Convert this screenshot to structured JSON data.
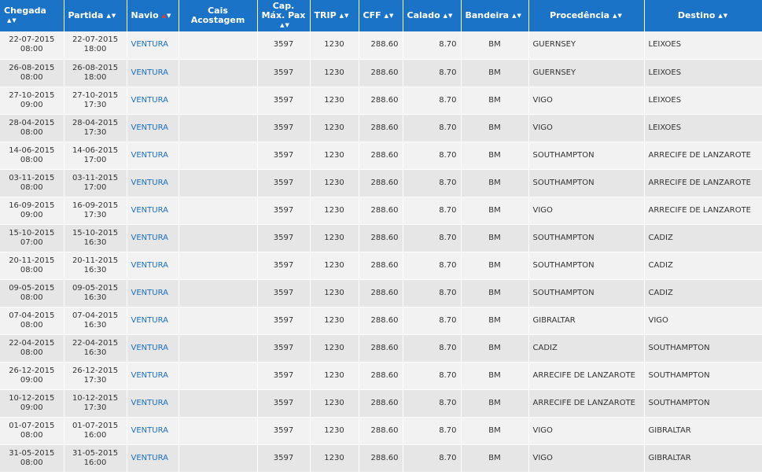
{
  "headers": [
    {
      "label": "Chegada",
      "sort": "both"
    },
    {
      "label": "Partida",
      "sort": "both"
    },
    {
      "label": "Navio",
      "sort": "up-active"
    },
    {
      "label": "Cais Acostagem",
      "sort": "none"
    },
    {
      "label": "Cap. Máx. Pax",
      "sort": "both"
    },
    {
      "label": "TRIP",
      "sort": "both"
    },
    {
      "label": "CFF",
      "sort": "both"
    },
    {
      "label": "Calado",
      "sort": "both"
    },
    {
      "label": "Bandeira",
      "sort": "both"
    },
    {
      "label": "Procedência",
      "sort": "both"
    },
    {
      "label": "Destino",
      "sort": "both"
    }
  ],
  "rows": [
    {
      "arr_date": "22-07-2015",
      "arr_time": "08:00",
      "dep_date": "22-07-2015",
      "dep_time": "18:00",
      "ship": "VENTURA",
      "berth": "",
      "pax": "3597",
      "trip": "1230",
      "cff": "288.60",
      "draft": "8.70",
      "flag": "BM",
      "from": "GUERNSEY",
      "to": "LEIXOES"
    },
    {
      "arr_date": "26-08-2015",
      "arr_time": "08:00",
      "dep_date": "26-08-2015",
      "dep_time": "18:00",
      "ship": "VENTURA",
      "berth": "",
      "pax": "3597",
      "trip": "1230",
      "cff": "288.60",
      "draft": "8.70",
      "flag": "BM",
      "from": "GUERNSEY",
      "to": "LEIXOES"
    },
    {
      "arr_date": "27-10-2015",
      "arr_time": "09:00",
      "dep_date": "27-10-2015",
      "dep_time": "17:30",
      "ship": "VENTURA",
      "berth": "",
      "pax": "3597",
      "trip": "1230",
      "cff": "288.60",
      "draft": "8.70",
      "flag": "BM",
      "from": "VIGO",
      "to": "LEIXOES"
    },
    {
      "arr_date": "28-04-2015",
      "arr_time": "08:00",
      "dep_date": "28-04-2015",
      "dep_time": "17:30",
      "ship": "VENTURA",
      "berth": "",
      "pax": "3597",
      "trip": "1230",
      "cff": "288.60",
      "draft": "8.70",
      "flag": "BM",
      "from": "VIGO",
      "to": "LEIXOES"
    },
    {
      "arr_date": "14-06-2015",
      "arr_time": "08:00",
      "dep_date": "14-06-2015",
      "dep_time": "17:00",
      "ship": "VENTURA",
      "berth": "",
      "pax": "3597",
      "trip": "1230",
      "cff": "288.60",
      "draft": "8.70",
      "flag": "BM",
      "from": "SOUTHAMPTON",
      "to": "ARRECIFE DE LANZAROTE"
    },
    {
      "arr_date": "03-11-2015",
      "arr_time": "08:00",
      "dep_date": "03-11-2015",
      "dep_time": "17:00",
      "ship": "VENTURA",
      "berth": "",
      "pax": "3597",
      "trip": "1230",
      "cff": "288.60",
      "draft": "8.70",
      "flag": "BM",
      "from": "SOUTHAMPTON",
      "to": "ARRECIFE DE LANZAROTE"
    },
    {
      "arr_date": "16-09-2015",
      "arr_time": "09:00",
      "dep_date": "16-09-2015",
      "dep_time": "17:30",
      "ship": "VENTURA",
      "berth": "",
      "pax": "3597",
      "trip": "1230",
      "cff": "288.60",
      "draft": "8.70",
      "flag": "BM",
      "from": "VIGO",
      "to": "ARRECIFE DE LANZAROTE"
    },
    {
      "arr_date": "15-10-2015",
      "arr_time": "07:00",
      "dep_date": "15-10-2015",
      "dep_time": "16:30",
      "ship": "VENTURA",
      "berth": "",
      "pax": "3597",
      "trip": "1230",
      "cff": "288.60",
      "draft": "8.70",
      "flag": "BM",
      "from": "SOUTHAMPTON",
      "to": "CADIZ"
    },
    {
      "arr_date": "20-11-2015",
      "arr_time": "08:00",
      "dep_date": "20-11-2015",
      "dep_time": "16:30",
      "ship": "VENTURA",
      "berth": "",
      "pax": "3597",
      "trip": "1230",
      "cff": "288.60",
      "draft": "8.70",
      "flag": "BM",
      "from": "SOUTHAMPTON",
      "to": "CADIZ"
    },
    {
      "arr_date": "09-05-2015",
      "arr_time": "08:00",
      "dep_date": "09-05-2015",
      "dep_time": "16:30",
      "ship": "VENTURA",
      "berth": "",
      "pax": "3597",
      "trip": "1230",
      "cff": "288.60",
      "draft": "8.70",
      "flag": "BM",
      "from": "SOUTHAMPTON",
      "to": "CADIZ"
    },
    {
      "arr_date": "07-04-2015",
      "arr_time": "08:00",
      "dep_date": "07-04-2015",
      "dep_time": "16:30",
      "ship": "VENTURA",
      "berth": "",
      "pax": "3597",
      "trip": "1230",
      "cff": "288.60",
      "draft": "8.70",
      "flag": "BM",
      "from": "GIBRALTAR",
      "to": "VIGO"
    },
    {
      "arr_date": "22-04-2015",
      "arr_time": "08:00",
      "dep_date": "22-04-2015",
      "dep_time": "16:30",
      "ship": "VENTURA",
      "berth": "",
      "pax": "3597",
      "trip": "1230",
      "cff": "288.60",
      "draft": "8.70",
      "flag": "BM",
      "from": "CADIZ",
      "to": "SOUTHAMPTON"
    },
    {
      "arr_date": "26-12-2015",
      "arr_time": "09:00",
      "dep_date": "26-12-2015",
      "dep_time": "17:30",
      "ship": "VENTURA",
      "berth": "",
      "pax": "3597",
      "trip": "1230",
      "cff": "288.60",
      "draft": "8.70",
      "flag": "BM",
      "from": "ARRECIFE DE LANZAROTE",
      "to": "SOUTHAMPTON"
    },
    {
      "arr_date": "10-12-2015",
      "arr_time": "09:00",
      "dep_date": "10-12-2015",
      "dep_time": "17:30",
      "ship": "VENTURA",
      "berth": "",
      "pax": "3597",
      "trip": "1230",
      "cff": "288.60",
      "draft": "8.70",
      "flag": "BM",
      "from": "ARRECIFE DE LANZAROTE",
      "to": "SOUTHAMPTON"
    },
    {
      "arr_date": "01-07-2015",
      "arr_time": "08:00",
      "dep_date": "01-07-2015",
      "dep_time": "16:00",
      "ship": "VENTURA",
      "berth": "",
      "pax": "3597",
      "trip": "1230",
      "cff": "288.60",
      "draft": "8.70",
      "flag": "BM",
      "from": "VIGO",
      "to": "GIBRALTAR"
    },
    {
      "arr_date": "31-05-2015",
      "arr_time": "08:00",
      "dep_date": "31-05-2015",
      "dep_time": "16:00",
      "ship": "VENTURA",
      "berth": "",
      "pax": "3597",
      "trip": "1230",
      "cff": "288.60",
      "draft": "8.70",
      "flag": "BM",
      "from": "VIGO",
      "to": "GIBRALTAR"
    }
  ],
  "colors": {
    "header_bg": "#1b73c7",
    "header_text": "#ffffff",
    "row_odd": "#f2f2f2",
    "row_even": "#e6e6e6",
    "link": "#1b6fc0",
    "sort_active": "#e23b3b"
  }
}
